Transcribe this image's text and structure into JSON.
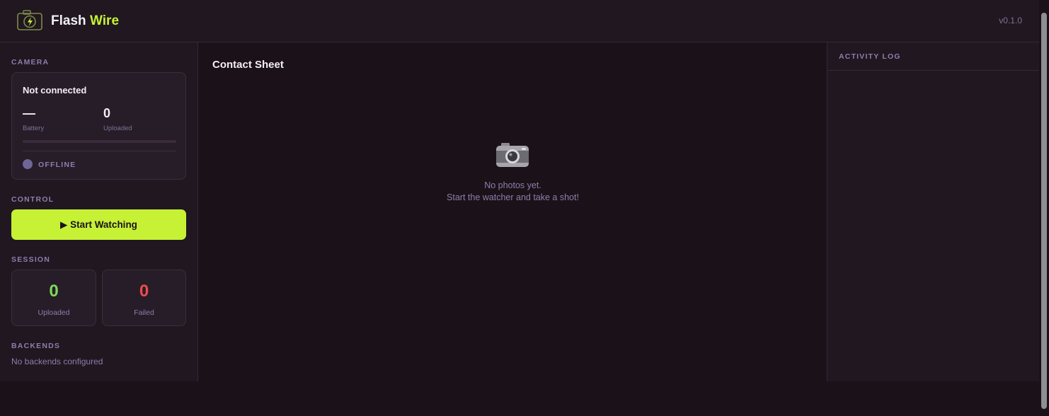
{
  "header": {
    "brand_first": "Flash",
    "brand_second": "Wire",
    "version": "v0.1.0",
    "logo_icon": "camera-bolt-icon"
  },
  "sidebar": {
    "camera": {
      "section_label": "CAMERA",
      "status": "Not connected",
      "battery_value": "—",
      "battery_label": "Battery",
      "uploaded_value": "0",
      "uploaded_label": "Uploaded",
      "progress": 0,
      "connection_state": "OFFLINE"
    },
    "control": {
      "section_label": "CONTROL",
      "start_button": "▶ Start Watching"
    },
    "session": {
      "section_label": "SESSION",
      "uploaded_value": "0",
      "uploaded_label": "Uploaded",
      "failed_value": "0",
      "failed_label": "Failed"
    },
    "backends": {
      "section_label": "BACKENDS",
      "empty_text": "No backends configured"
    }
  },
  "main": {
    "title": "Contact Sheet",
    "empty_icon": "camera-icon",
    "empty_line1": "No photos yet.",
    "empty_line2": "Start the watcher and take a shot!"
  },
  "activity_log": {
    "title": "ACTIVITY LOG"
  },
  "colors": {
    "accent": "#c6f135",
    "success": "#7ed957",
    "danger": "#ea4d4d",
    "background": "#1b1219",
    "panel": "#201720",
    "muted": "#8a7fac"
  }
}
